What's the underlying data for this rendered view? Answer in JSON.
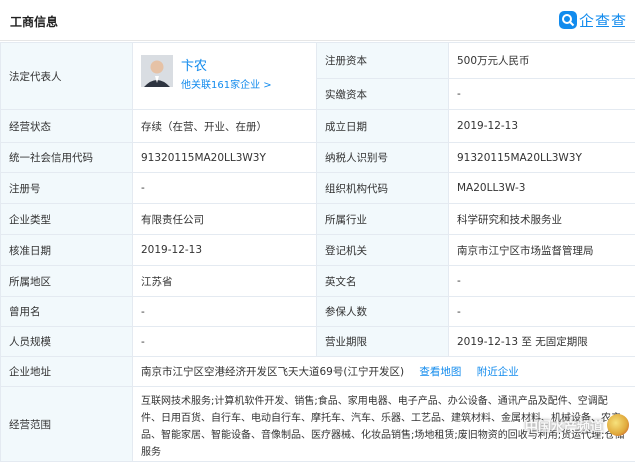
{
  "header": {
    "title": "工商信息",
    "brand": "企查查",
    "brand_icon": "qcc-logo-icon"
  },
  "legal_rep": {
    "label": "法定代表人",
    "name": "卞农",
    "link": "他关联161家企业 >"
  },
  "rows": {
    "reg_capital": {
      "label": "注册资本",
      "value": "500万元人民币"
    },
    "paid_capital": {
      "label": "实缴资本",
      "value": "-"
    },
    "status": {
      "label": "经营状态",
      "value": "存续（在营、开业、在册）"
    },
    "est_date": {
      "label": "成立日期",
      "value": "2019-12-13"
    },
    "credit_code": {
      "label": "统一社会信用代码",
      "value": "91320115MA20LL3W3Y"
    },
    "taxpayer_id": {
      "label": "纳税人识别号",
      "value": "91320115MA20LL3W3Y"
    },
    "reg_no": {
      "label": "注册号",
      "value": "-"
    },
    "org_code": {
      "label": "组织机构代码",
      "value": "MA20LL3W-3"
    },
    "company_type": {
      "label": "企业类型",
      "value": "有限责任公司"
    },
    "industry": {
      "label": "所属行业",
      "value": "科学研究和技术服务业"
    },
    "approval_date": {
      "label": "核准日期",
      "value": "2019-12-13"
    },
    "authority": {
      "label": "登记机关",
      "value": "南京市江宁区市场监督管理局"
    },
    "region": {
      "label": "所属地区",
      "value": "江苏省"
    },
    "english_name": {
      "label": "英文名",
      "value": "-"
    },
    "former_name": {
      "label": "曾用名",
      "value": "-"
    },
    "insured": {
      "label": "参保人数",
      "value": "-"
    },
    "staff_size": {
      "label": "人员规模",
      "value": "-"
    },
    "term": {
      "label": "营业期限",
      "value": "2019-12-13 至 无固定期限"
    },
    "address": {
      "label": "企业地址",
      "value": "南京市江宁区空港经济开发区飞天大道69号(江宁开发区)",
      "map_link": "查看地图",
      "nearby_link": "附近企业"
    },
    "scope": {
      "label": "经营范围",
      "value": "互联网技术服务;计算机软件开发、销售;食品、家用电器、电子产品、办公设备、通讯产品及配件、空调配件、日用百货、自行车、电动自行车、摩托车、汽车、乐器、工艺品、建筑材料、金属材料、机械设备、农产品、智能家居、智能设备、音像制品、医疗器械、化妆品销售;场地租赁;废旧物资的回收与利用;货运代理;仓储服务"
    }
  },
  "watermark": {
    "text": "中国水产频道",
    "icon": "watermark-emblem-icon"
  }
}
